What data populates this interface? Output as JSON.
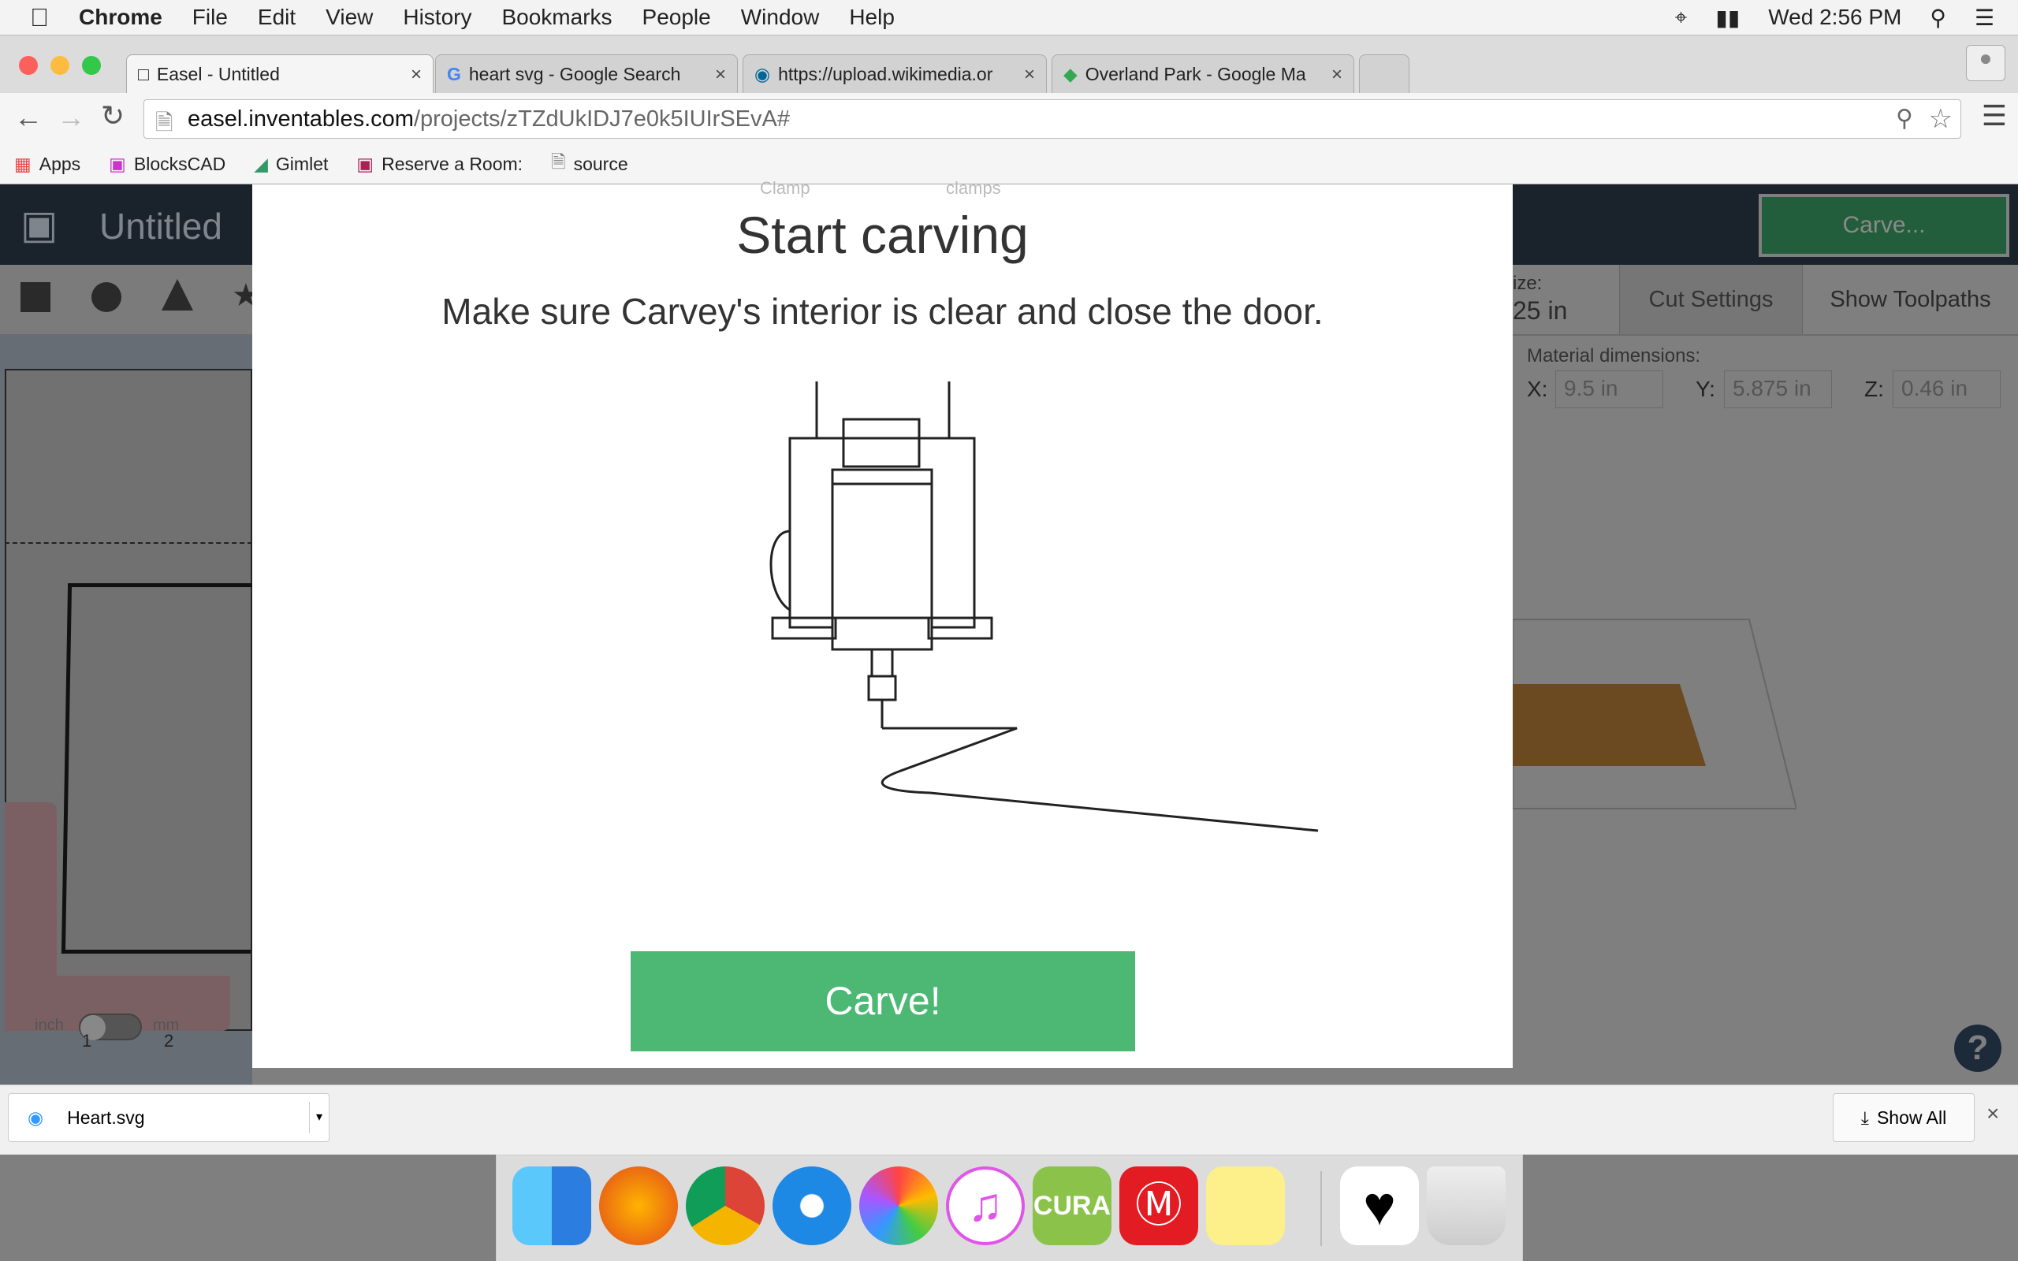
{
  "menubar": {
    "items": [
      "Chrome",
      "File",
      "Edit",
      "View",
      "History",
      "Bookmarks",
      "People",
      "Window",
      "Help"
    ],
    "clock": "Wed 2:56 PM"
  },
  "tabs": [
    {
      "title": "Easel - Untitled",
      "active": true
    },
    {
      "title": "heart svg - Google Search"
    },
    {
      "title": "https://upload.wikimedia.or"
    },
    {
      "title": "Overland Park - Google Ma"
    }
  ],
  "address": {
    "host": "easel.inventables.com",
    "path": "/projects/zTZdUkIDJ7e0k5IUIrSEvA#"
  },
  "bookmarks": [
    "Apps",
    "BlocksCAD",
    "Gimlet",
    "Reserve a Room:",
    "source"
  ],
  "app": {
    "title": "Untitled",
    "carve_button": "Carve...",
    "size_label": "ize:",
    "size_value": "25 in",
    "cut_settings": "Cut Settings",
    "show_toolpaths": "Show Toolpaths",
    "material_label": "Material dimensions:",
    "x_label": "X:",
    "x_value": "9.5 in",
    "y_label": "Y:",
    "y_value": "5.875 in",
    "z_label": "Z:",
    "z_value": "0.46 in",
    "ruler": [
      "1",
      "2"
    ],
    "unit_inch": "inch",
    "unit_mm": "mm",
    "help": "?",
    "bg_labels": [
      "Clamp",
      "clamps"
    ]
  },
  "modal": {
    "title": "Start carving",
    "message": "Make sure Carvey's interior is clear and close the door.",
    "carve_button": "Carve!",
    "accent": "#4cb874"
  },
  "download": {
    "file": "Heart.svg",
    "show_all": "Show All"
  },
  "dock": {
    "apps": [
      "Finder",
      "Firefox",
      "Chrome",
      "Safari",
      "Photos",
      "iTunes",
      "Cura",
      "MakerBot",
      "Stickies",
      "Heart",
      "Trash"
    ]
  }
}
